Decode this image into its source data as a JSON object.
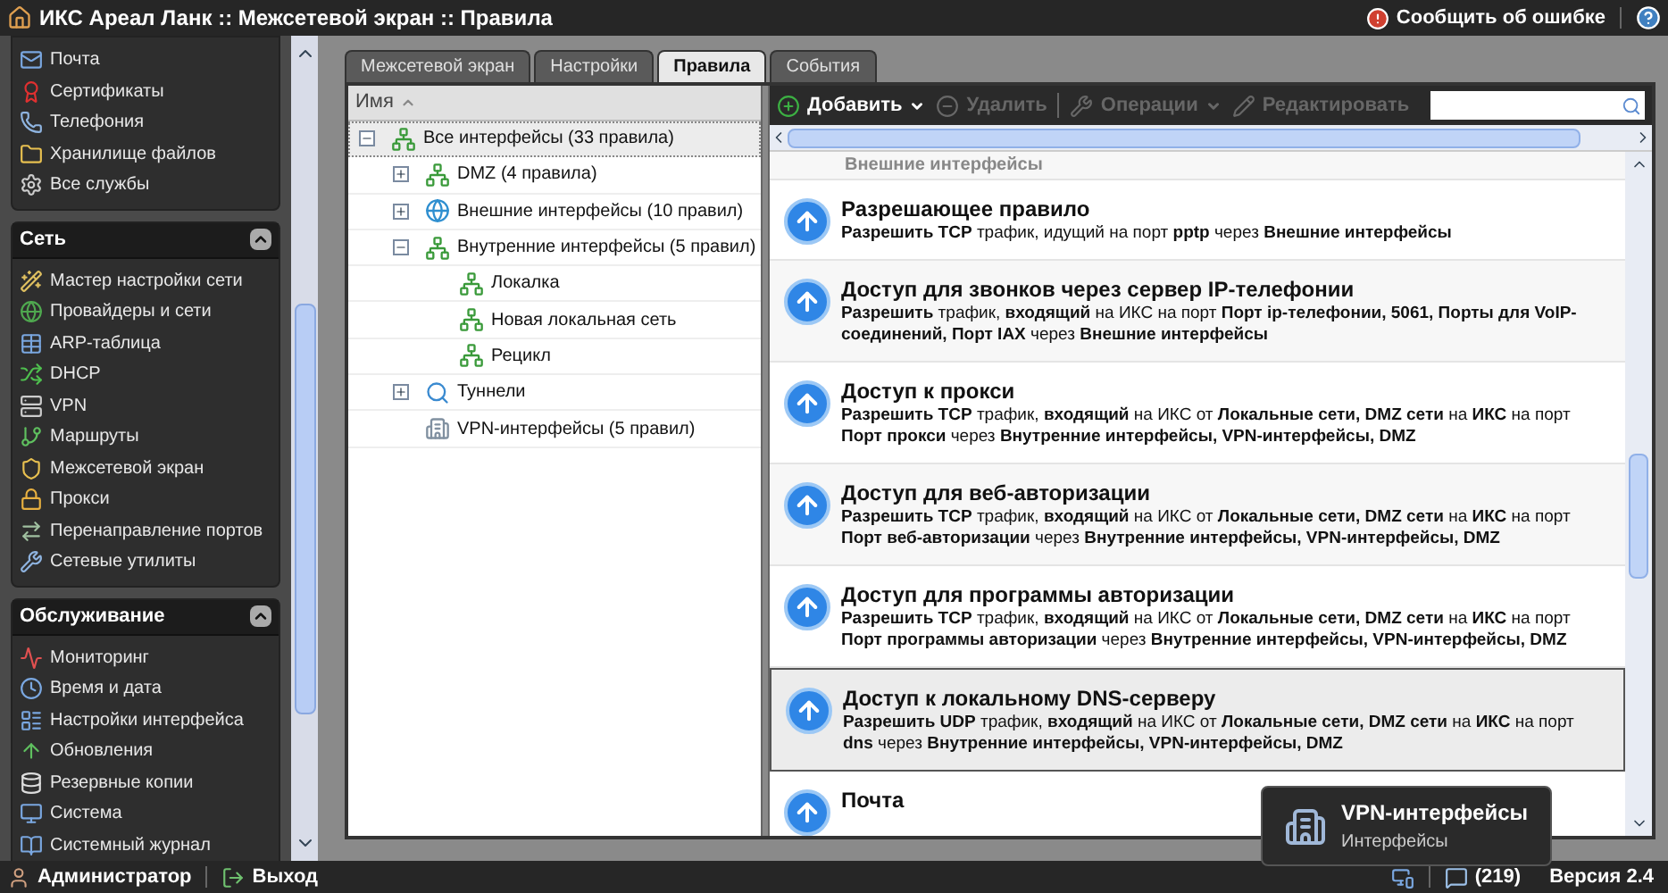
{
  "window": {
    "title": "ИКС Ареал Ланк :: Межсетевой экран :: Правила",
    "report_link": "Сообщить об ошибке"
  },
  "sidebar": {
    "top_items": [
      "Почта",
      "Сертификаты",
      "Телефония",
      "Хранилище файлов",
      "Все службы"
    ],
    "sections": [
      {
        "title": "Сеть",
        "expanded": true,
        "items": [
          "Мастер настройки сети",
          "Провайдеры и сети",
          "ARP-таблица",
          "DHCP",
          "VPN",
          "Маршруты",
          "Межсетевой экран",
          "Прокси",
          "Перенаправление портов",
          "Сетевые утилиты"
        ]
      },
      {
        "title": "Обслуживание",
        "expanded": true,
        "items": [
          "Мониторинг",
          "Время и дата",
          "Настройки интерфейса",
          "Обновления",
          "Резервные копии",
          "Система",
          "Системный журнал"
        ]
      }
    ]
  },
  "tabs": [
    {
      "label": "Межсетевой экран",
      "selected": false
    },
    {
      "label": "Настройки",
      "selected": false
    },
    {
      "label": "Правила",
      "selected": true
    },
    {
      "label": "События",
      "selected": false
    }
  ],
  "tree": {
    "column": "Имя",
    "items": [
      {
        "label": "Все интерфейсы (33 правила)",
        "kind": "network",
        "expanded": true,
        "selected": true,
        "children": [
          {
            "label": "DMZ (4 правила)",
            "kind": "network",
            "expanded": false,
            "selected": false
          },
          {
            "label": "Внешние интерфейсы (10 правил)",
            "kind": "globe",
            "expanded": false,
            "selected": false
          },
          {
            "label": "Внутренние интерфейсы (5 правил)",
            "kind": "network",
            "expanded": true,
            "selected": false,
            "children": [
              {
                "label": "Локалка",
                "kind": "network",
                "selected": false
              },
              {
                "label": "Новая локальная сеть",
                "kind": "network",
                "selected": false
              },
              {
                "label": "Рецикл",
                "kind": "network",
                "selected": false
              }
            ]
          },
          {
            "label": "Туннели",
            "kind": "search",
            "expanded": false,
            "selected": false
          },
          {
            "label": "VPN-интерфейсы (5 правил)",
            "kind": "building",
            "selected": false
          }
        ]
      }
    ]
  },
  "toolbar": {
    "buttons": [
      {
        "label": "Добавить",
        "kind": "add",
        "disabled": false,
        "dropdown": true
      },
      {
        "label": "Удалить",
        "kind": "delete",
        "disabled": true,
        "dropdown": false
      },
      {
        "label": "Операции",
        "kind": "tools",
        "disabled": true,
        "dropdown": true
      },
      {
        "label": "Редактировать",
        "kind": "edit",
        "disabled": true,
        "dropdown": false
      }
    ]
  },
  "rules": [
    {
      "kind": "continuation",
      "description": "Внешние интерфейсы",
      "selected": false
    },
    {
      "title": "Разрешающее правило",
      "description": "**Разрешить TCP** трафик, идущий на порт **pptp** через **Внешние интерфейсы**",
      "selected": false
    },
    {
      "title": "Доступ для звонков через сервер IP-телефонии",
      "description": "**Разрешить** трафик, **входящий** на ИКС на порт **Порт ip-телефонии, 5061, Порты для VoIP-соединений, Порт IAX** через **Внешние интерфейсы**",
      "selected": false
    },
    {
      "title": "Доступ к прокси",
      "description": "**Разрешить TCP** трафик, **входящий** на ИКС от **Локальные сети, DMZ сети** на **ИКС** на порт **Порт прокси** через **Внутренние интерфейсы, VPN-интерфейсы, DMZ**",
      "selected": false
    },
    {
      "title": "Доступ для веб-авторизации",
      "description": "**Разрешить TCP** трафик, **входящий** на ИКС от **Локальные сети, DMZ сети** на **ИКС** на порт **Порт веб-авторизации** через **Внутренние интерфейсы, VPN-интерфейсы, DMZ**",
      "selected": false
    },
    {
      "title": "Доступ для программы авторизации",
      "description": "**Разрешить TCP** трафик, **входящий** на ИКС от **Локальные сети, DMZ сети** на **ИКС** на порт **Порт программы авторизации** через **Внутренние интерфейсы, VPN-интерфейсы, DMZ**",
      "selected": false
    },
    {
      "title": "Доступ к локальному DNS-серверу",
      "description": "**Разрешить UDP** трафик, **входящий** на ИКС от **Локальные сети, DMZ сети** на **ИКС** на порт **dns** через **Внутренние интерфейсы, VPN-интерфейсы, DMZ**",
      "selected": true
    },
    {
      "title": "Почта",
      "selected": false
    }
  ],
  "toast": {
    "title": "VPN-интерфейсы",
    "subtitle": "Интерфейсы"
  },
  "status_bar": {
    "user": "Администратор",
    "logout": "Выход",
    "messages": "(219)",
    "version": "Версия 2.4"
  }
}
